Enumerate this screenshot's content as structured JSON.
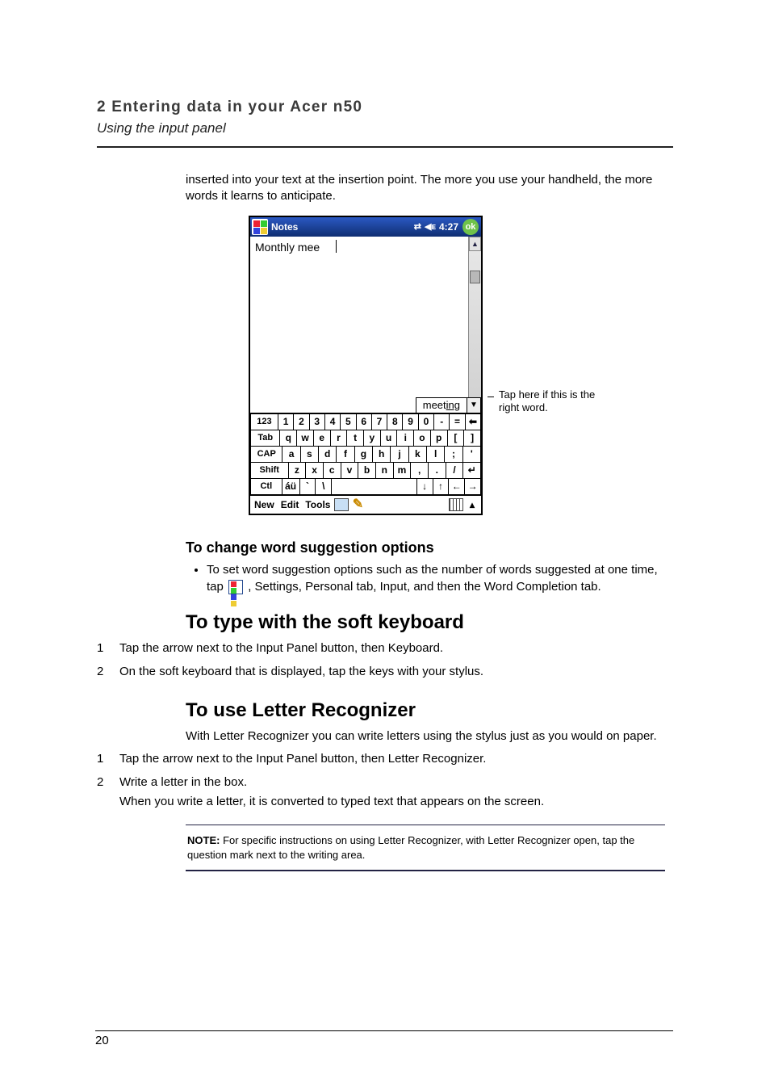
{
  "header": {
    "chapter": "2 Entering data in your Acer n50",
    "subtitle": "Using the input panel"
  },
  "intro_para": "inserted into your text at the insertion point. The more you use your handheld, the more words it learns to anticipate.",
  "pda": {
    "title": "Notes",
    "clock": "4:27",
    "ok": "ok",
    "note_text": "Monthly mee",
    "suggestion_prefix": "meet",
    "suggestion_suffix": "ing",
    "menu": {
      "new": "New",
      "edit": "Edit",
      "tools": "Tools"
    },
    "kbd": {
      "r1": [
        "123",
        "1",
        "2",
        "3",
        "4",
        "5",
        "6",
        "7",
        "8",
        "9",
        "0",
        "-",
        "=",
        "⬅"
      ],
      "r2": [
        "Tab",
        "q",
        "w",
        "e",
        "r",
        "t",
        "y",
        "u",
        "i",
        "o",
        "p",
        "[",
        "]"
      ],
      "r3": [
        "CAP",
        "a",
        "s",
        "d",
        "f",
        "g",
        "h",
        "j",
        "k",
        "l",
        ";",
        "'"
      ],
      "r4": [
        "Shift",
        "z",
        "x",
        "c",
        "v",
        "b",
        "n",
        "m",
        ",",
        ".",
        "/",
        "↵"
      ],
      "r5": [
        "Ctl",
        "áü",
        "`",
        "\\",
        "↓",
        "↑",
        "←",
        "→"
      ]
    }
  },
  "annotation": "Tap here if this is the right word.",
  "sec_change": {
    "title": "To change word suggestion options",
    "bullet_before": "To set word suggestion options such as the number of words suggested at one time, tap ",
    "bullet_after": " , Settings, Personal tab, Input, and then the Word Completion tab."
  },
  "sec_type": {
    "title": "To type with the soft keyboard",
    "step1": "Tap the arrow next to the Input Panel button, then Keyboard.",
    "step2": "On the soft keyboard that is displayed, tap the keys with your stylus."
  },
  "sec_letter": {
    "title": "To use Letter Recognizer",
    "intro": "With Letter Recognizer you can write letters using the stylus just as you would on paper.",
    "step1": "Tap the arrow next to the Input Panel button, then Letter Recognizer.",
    "step2a": "Write a letter in the box.",
    "step2b": "When you write a letter, it is converted to typed text that appears on the screen."
  },
  "note": {
    "label": "NOTE:",
    "text": "   For specific instructions on using Letter Recognizer, with Letter Recognizer open, tap the question mark next to the writing area."
  },
  "page_number": "20"
}
